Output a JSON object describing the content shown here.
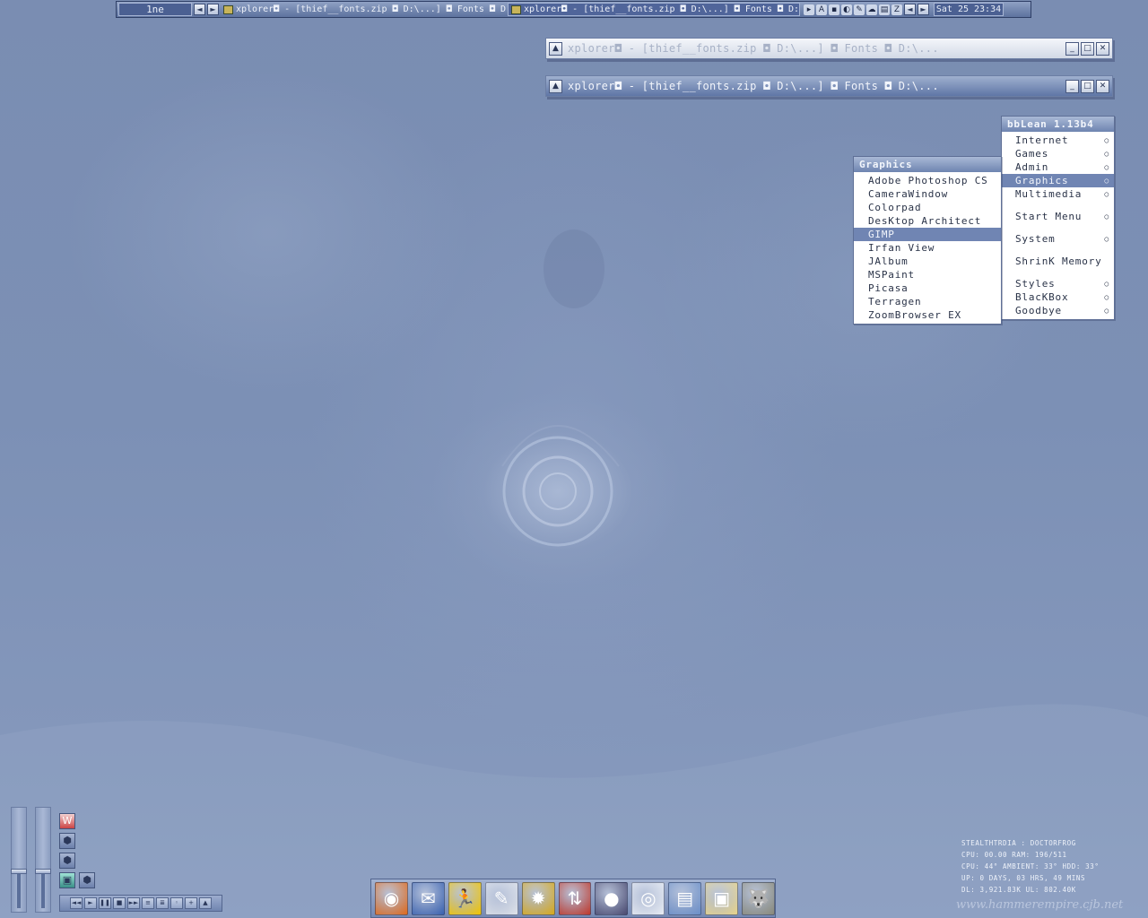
{
  "toolbar": {
    "workspace": "1ne",
    "prev_workspace": "◄",
    "next_workspace": "►",
    "task1_title": "xplorer◘ - [thief__fonts.zip ◘ D:\\...] ◘ Fonts ◘ D:...",
    "task2_title": "xplorer◘ - [thief__fonts.zip ◘ D:\\...] ◘ Fonts ◘ D:\\...",
    "tray_icons": [
      "menu-arrow-icon",
      "aim-icon",
      "network-icon",
      "shield-icon",
      "pen-icon",
      "cloud-icon",
      "folder-icon",
      "tz-icon"
    ],
    "tray_prev": "◄",
    "tray_next": "►",
    "clock": "Sat 25 23:34"
  },
  "windows": [
    {
      "title": "xplorer◘ - [thief__fonts.zip ◘ D:\\...] ◘ Fonts ◘ D:\\...",
      "state": "inactive"
    },
    {
      "title": "xplorer◘ - [thief__fonts.zip ◘ D:\\...] ◘ Fonts ◘ D:\\...",
      "state": "active"
    }
  ],
  "main_menu": {
    "title": "bbLean 1.13b4",
    "items": [
      {
        "label": "Internet",
        "submenu": true
      },
      {
        "label": "Games",
        "submenu": true
      },
      {
        "label": "Admin",
        "submenu": true
      },
      {
        "label": "Graphics",
        "submenu": true,
        "selected": true
      },
      {
        "label": "Multimedia",
        "submenu": true
      },
      {
        "label": "Start Menu",
        "submenu": true
      },
      {
        "label": "System",
        "submenu": true
      },
      {
        "label": "ShrinK Memory",
        "submenu": false
      },
      {
        "label": "Styles",
        "submenu": true
      },
      {
        "label": "BlacKBox",
        "submenu": true
      },
      {
        "label": "Goodbye",
        "submenu": true
      }
    ]
  },
  "graphics_menu": {
    "title": "Graphics",
    "items": [
      {
        "label": "Adobe Photoshop CS"
      },
      {
        "label": "CameraWindow"
      },
      {
        "label": "Colorpad"
      },
      {
        "label": "DesKtop Architect"
      },
      {
        "label": "GIMP",
        "selected": true
      },
      {
        "label": "Irfan View"
      },
      {
        "label": "JAlbum"
      },
      {
        "label": "MSPaint"
      },
      {
        "label": "Picasa"
      },
      {
        "label": "Terragen"
      },
      {
        "label": "ZoomBrowser EX"
      }
    ]
  },
  "sysinfo": {
    "line1": "STEALTHTRDIA : DOCTORFROG",
    "line2": "CPU: 00.00    RAM: 196/511",
    "line3": "CPU: 44°  AMBIENT: 33°  HDD: 33°",
    "line4": "UP: 0 DAYS, 03 HRS, 49 MINS",
    "line5": "DL: 3,921.83K   UL: 802.40K"
  },
  "watermark": "www.hammerempire.cjb.net",
  "volume_sliders": [
    0.38,
    0.38
  ],
  "side_buttons": [
    "winamp-icon",
    "hex-icon",
    "hex-icon",
    "square-icon",
    "hex-icon"
  ],
  "media_controls": [
    "prev",
    "play",
    "pause",
    "stop",
    "next",
    "eq",
    "playlist",
    "options",
    "add",
    "up"
  ],
  "media_glyphs": [
    "◄◄",
    "►",
    "❚❚",
    "■",
    "►►",
    "≡",
    "≣",
    "◦",
    "+",
    "▲"
  ],
  "dock": [
    {
      "name": "firefox-icon",
      "color": "#e06a1c",
      "glyph": "◉"
    },
    {
      "name": "thunderbird-icon",
      "color": "#3a62b0",
      "glyph": "✉"
    },
    {
      "name": "aim-running-man-icon",
      "color": "#f2c500",
      "glyph": "🏃"
    },
    {
      "name": "editor-pen-icon",
      "color": "#dfe3ea",
      "glyph": "✎"
    },
    {
      "name": "gear-sun-icon",
      "color": "#d8a91a",
      "glyph": "✹"
    },
    {
      "name": "transfer-arrows-icon",
      "color": "#c0392b",
      "glyph": "⇅"
    },
    {
      "name": "planet-icon",
      "color": "#4a4a70",
      "glyph": "●"
    },
    {
      "name": "picasa-icon",
      "color": "#e9edf4",
      "glyph": "◎"
    },
    {
      "name": "network-computer-icon",
      "color": "#6b8fc8",
      "glyph": "▤"
    },
    {
      "name": "explorer-window-icon",
      "color": "#e8d48a",
      "glyph": "▣"
    },
    {
      "name": "gimp-icon",
      "color": "#8a8a7a",
      "glyph": "🐺"
    }
  ]
}
